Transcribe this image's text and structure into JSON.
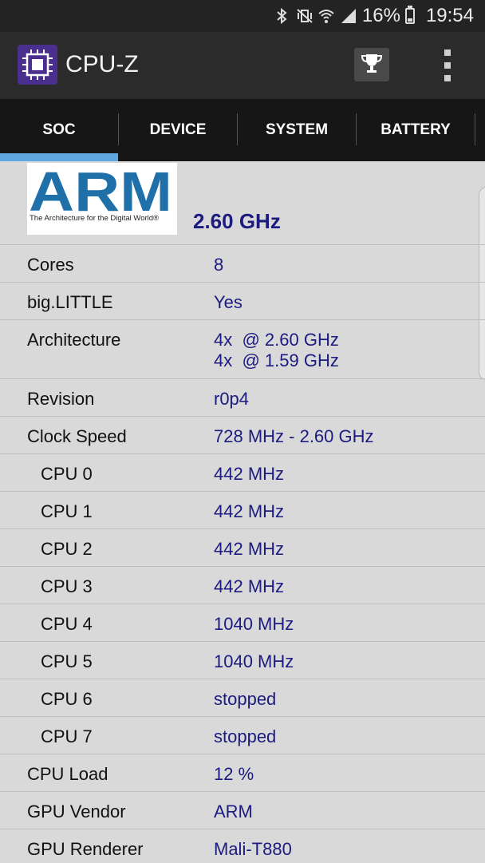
{
  "status_bar": {
    "battery_percent": "16%",
    "time": "19:54",
    "icons": [
      "bluetooth-icon",
      "vibrate-mute-icon",
      "wifi-icon",
      "cell-signal-icon",
      "battery-icon"
    ]
  },
  "app_bar": {
    "title": "CPU-Z",
    "icons": [
      "cpu-chip-logo-icon",
      "trophy-icon",
      "overflow-menu-icon"
    ]
  },
  "tabs": [
    {
      "label": "SOC",
      "selected": true
    },
    {
      "label": "DEVICE",
      "selected": false
    },
    {
      "label": "SYSTEM",
      "selected": false
    },
    {
      "label": "BATTERY",
      "selected": false
    }
  ],
  "soc": {
    "logo_text": "ARM",
    "logo_tagline": "The Architecture for the Digital World®",
    "max_frequency": "2.60 GHz",
    "rows": [
      {
        "label": "Cores",
        "value": "8"
      },
      {
        "label": "big.LITTLE",
        "value": "Yes"
      },
      {
        "label": "Architecture",
        "value": "4x  @ 2.60 GHz",
        "value2": "4x  @ 1.59 GHz"
      },
      {
        "label": "Revision",
        "value": "r0p4"
      },
      {
        "label": "Clock Speed",
        "value": "728 MHz - 2.60 GHz"
      },
      {
        "label": "CPU 0",
        "value": "442 MHz"
      },
      {
        "label": "CPU 1",
        "value": "442 MHz"
      },
      {
        "label": "CPU 2",
        "value": "442 MHz"
      },
      {
        "label": "CPU 3",
        "value": "442 MHz"
      },
      {
        "label": "CPU 4",
        "value": "1040 MHz"
      },
      {
        "label": "CPU 5",
        "value": "1040 MHz"
      },
      {
        "label": "CPU 6",
        "value": "stopped"
      },
      {
        "label": "CPU 7",
        "value": "stopped"
      },
      {
        "label": "CPU Load",
        "value": "12 %"
      },
      {
        "label": "GPU Vendor",
        "value": "ARM"
      },
      {
        "label": "GPU Renderer",
        "value": "Mali-T880"
      }
    ]
  },
  "colors": {
    "value_text": "#1b1b80",
    "tab_indicator": "#5fa7e0",
    "app_bar": "#2b2b2b",
    "tab_bar": "#161616",
    "logo_bg": "#4a2f8f",
    "arm_blue": "#1f6fa8"
  }
}
